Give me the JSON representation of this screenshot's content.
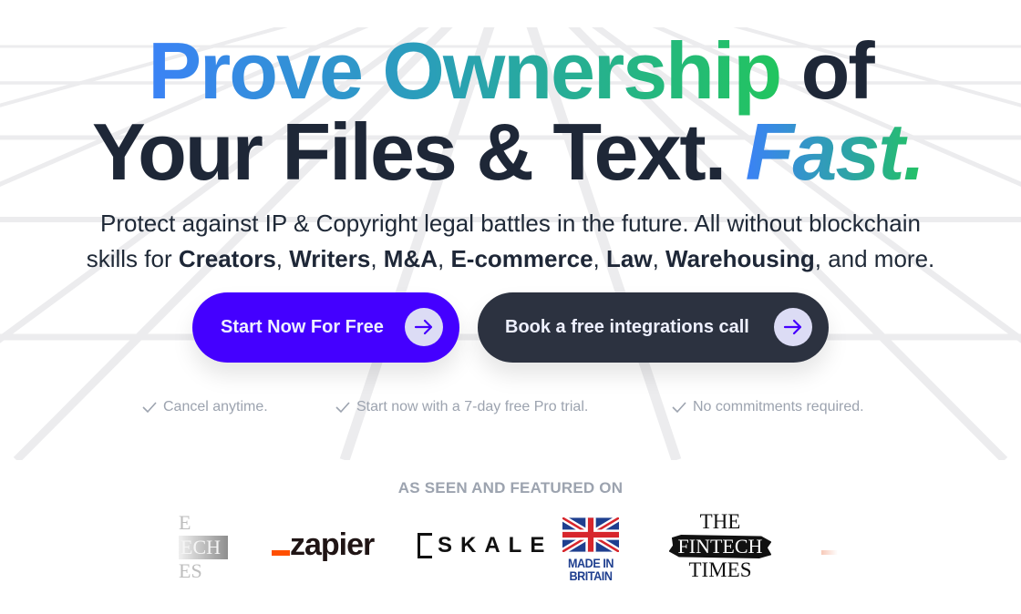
{
  "hero": {
    "headline": {
      "line1_gradient": "Prove Ownership",
      "line1_plain": " of",
      "line2_plain": "Your Files & Text.",
      "line2_accent": "Fast."
    },
    "subheadline": {
      "line1": "Protect against IP & Copyright legal battles in the future. All without blockchain",
      "prefix": "skills for ",
      "industries": [
        "Creators",
        "Writers",
        "M&A",
        "E-commerce",
        "Law",
        "Warehousing"
      ],
      "suffix": ", and more."
    },
    "buttons": {
      "primary": {
        "label": "Start Now For Free",
        "icon": "arrow-right-icon"
      },
      "secondary": {
        "label": "Book a free integrations call",
        "icon": "arrow-right-icon"
      }
    },
    "benefits": [
      {
        "icon": "checkmark-icon",
        "text": "Cancel anytime."
      },
      {
        "icon": "checkmark-icon",
        "text": "Start now with a 7-day free Pro trial."
      },
      {
        "icon": "checkmark-icon",
        "text": "No commitments required."
      }
    ]
  },
  "featured": {
    "heading": "AS SEEN AND FEATURED ON",
    "logos": [
      {
        "name": "The Fintech Times (partial)",
        "text_top": "E",
        "text_mid": "ECH",
        "text_bottom": "ES"
      },
      {
        "name": "Zapier",
        "text": "zapier"
      },
      {
        "name": "SKALE",
        "text": "SKALE"
      },
      {
        "name": "Made in Britain",
        "text_line1": "MADE IN",
        "text_line2": "BRITAIN"
      },
      {
        "name": "The Fintech Times",
        "text_top": "THE",
        "text_mid": "FINTECH",
        "text_bottom": "TIMES"
      }
    ]
  },
  "colors": {
    "primary_button": "#4400ff",
    "secondary_button": "#2c3240",
    "heading_dark": "#1e2737",
    "gradient_start": "#3b82f6",
    "gradient_end": "#22c55e",
    "muted_text": "#9ca3af",
    "zapier_orange": "#ff4f00",
    "union_jack_blue": "#1f3f8f",
    "union_jack_red": "#d7262c"
  }
}
